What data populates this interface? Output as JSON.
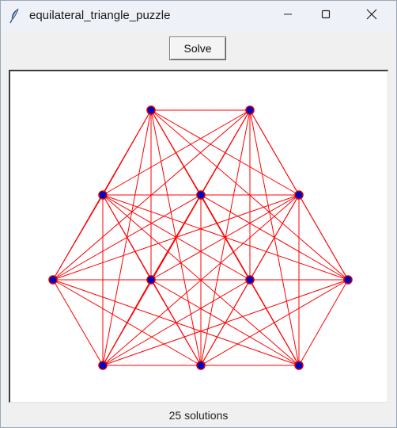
{
  "window": {
    "title": "equilateral_triangle_puzzle",
    "icon": "feather-icon",
    "controls": [
      "minimize-icon",
      "maximize-icon",
      "close-icon"
    ]
  },
  "toolbar": {
    "solve_label": "Solve"
  },
  "canvas": {
    "background": "#ffffff",
    "line_color": "#ff0000",
    "node_fill": "#0000cc",
    "node_outline": "#cc0000"
  },
  "status": {
    "text": "25 solutions"
  }
}
